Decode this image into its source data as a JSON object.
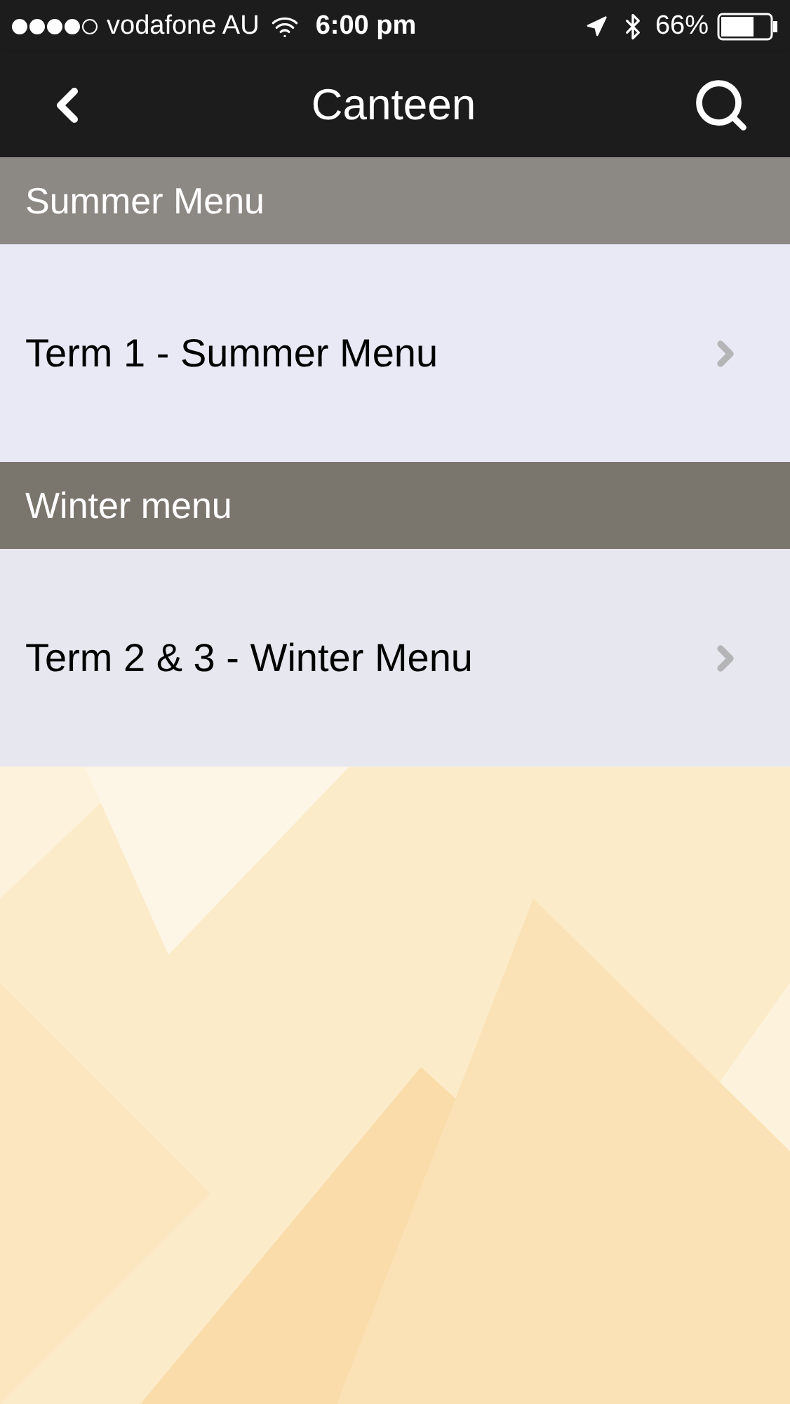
{
  "status_bar": {
    "carrier": "vodafone AU",
    "time": "6:00 pm",
    "battery": "66%"
  },
  "nav_bar": {
    "title": "Canteen"
  },
  "sections": [
    {
      "header": "Summer Menu",
      "items": [
        {
          "label": "Term 1 - Summer Menu"
        }
      ]
    },
    {
      "header": "Winter menu",
      "items": [
        {
          "label": "Term 2 & 3 - Winter Menu"
        }
      ]
    }
  ]
}
